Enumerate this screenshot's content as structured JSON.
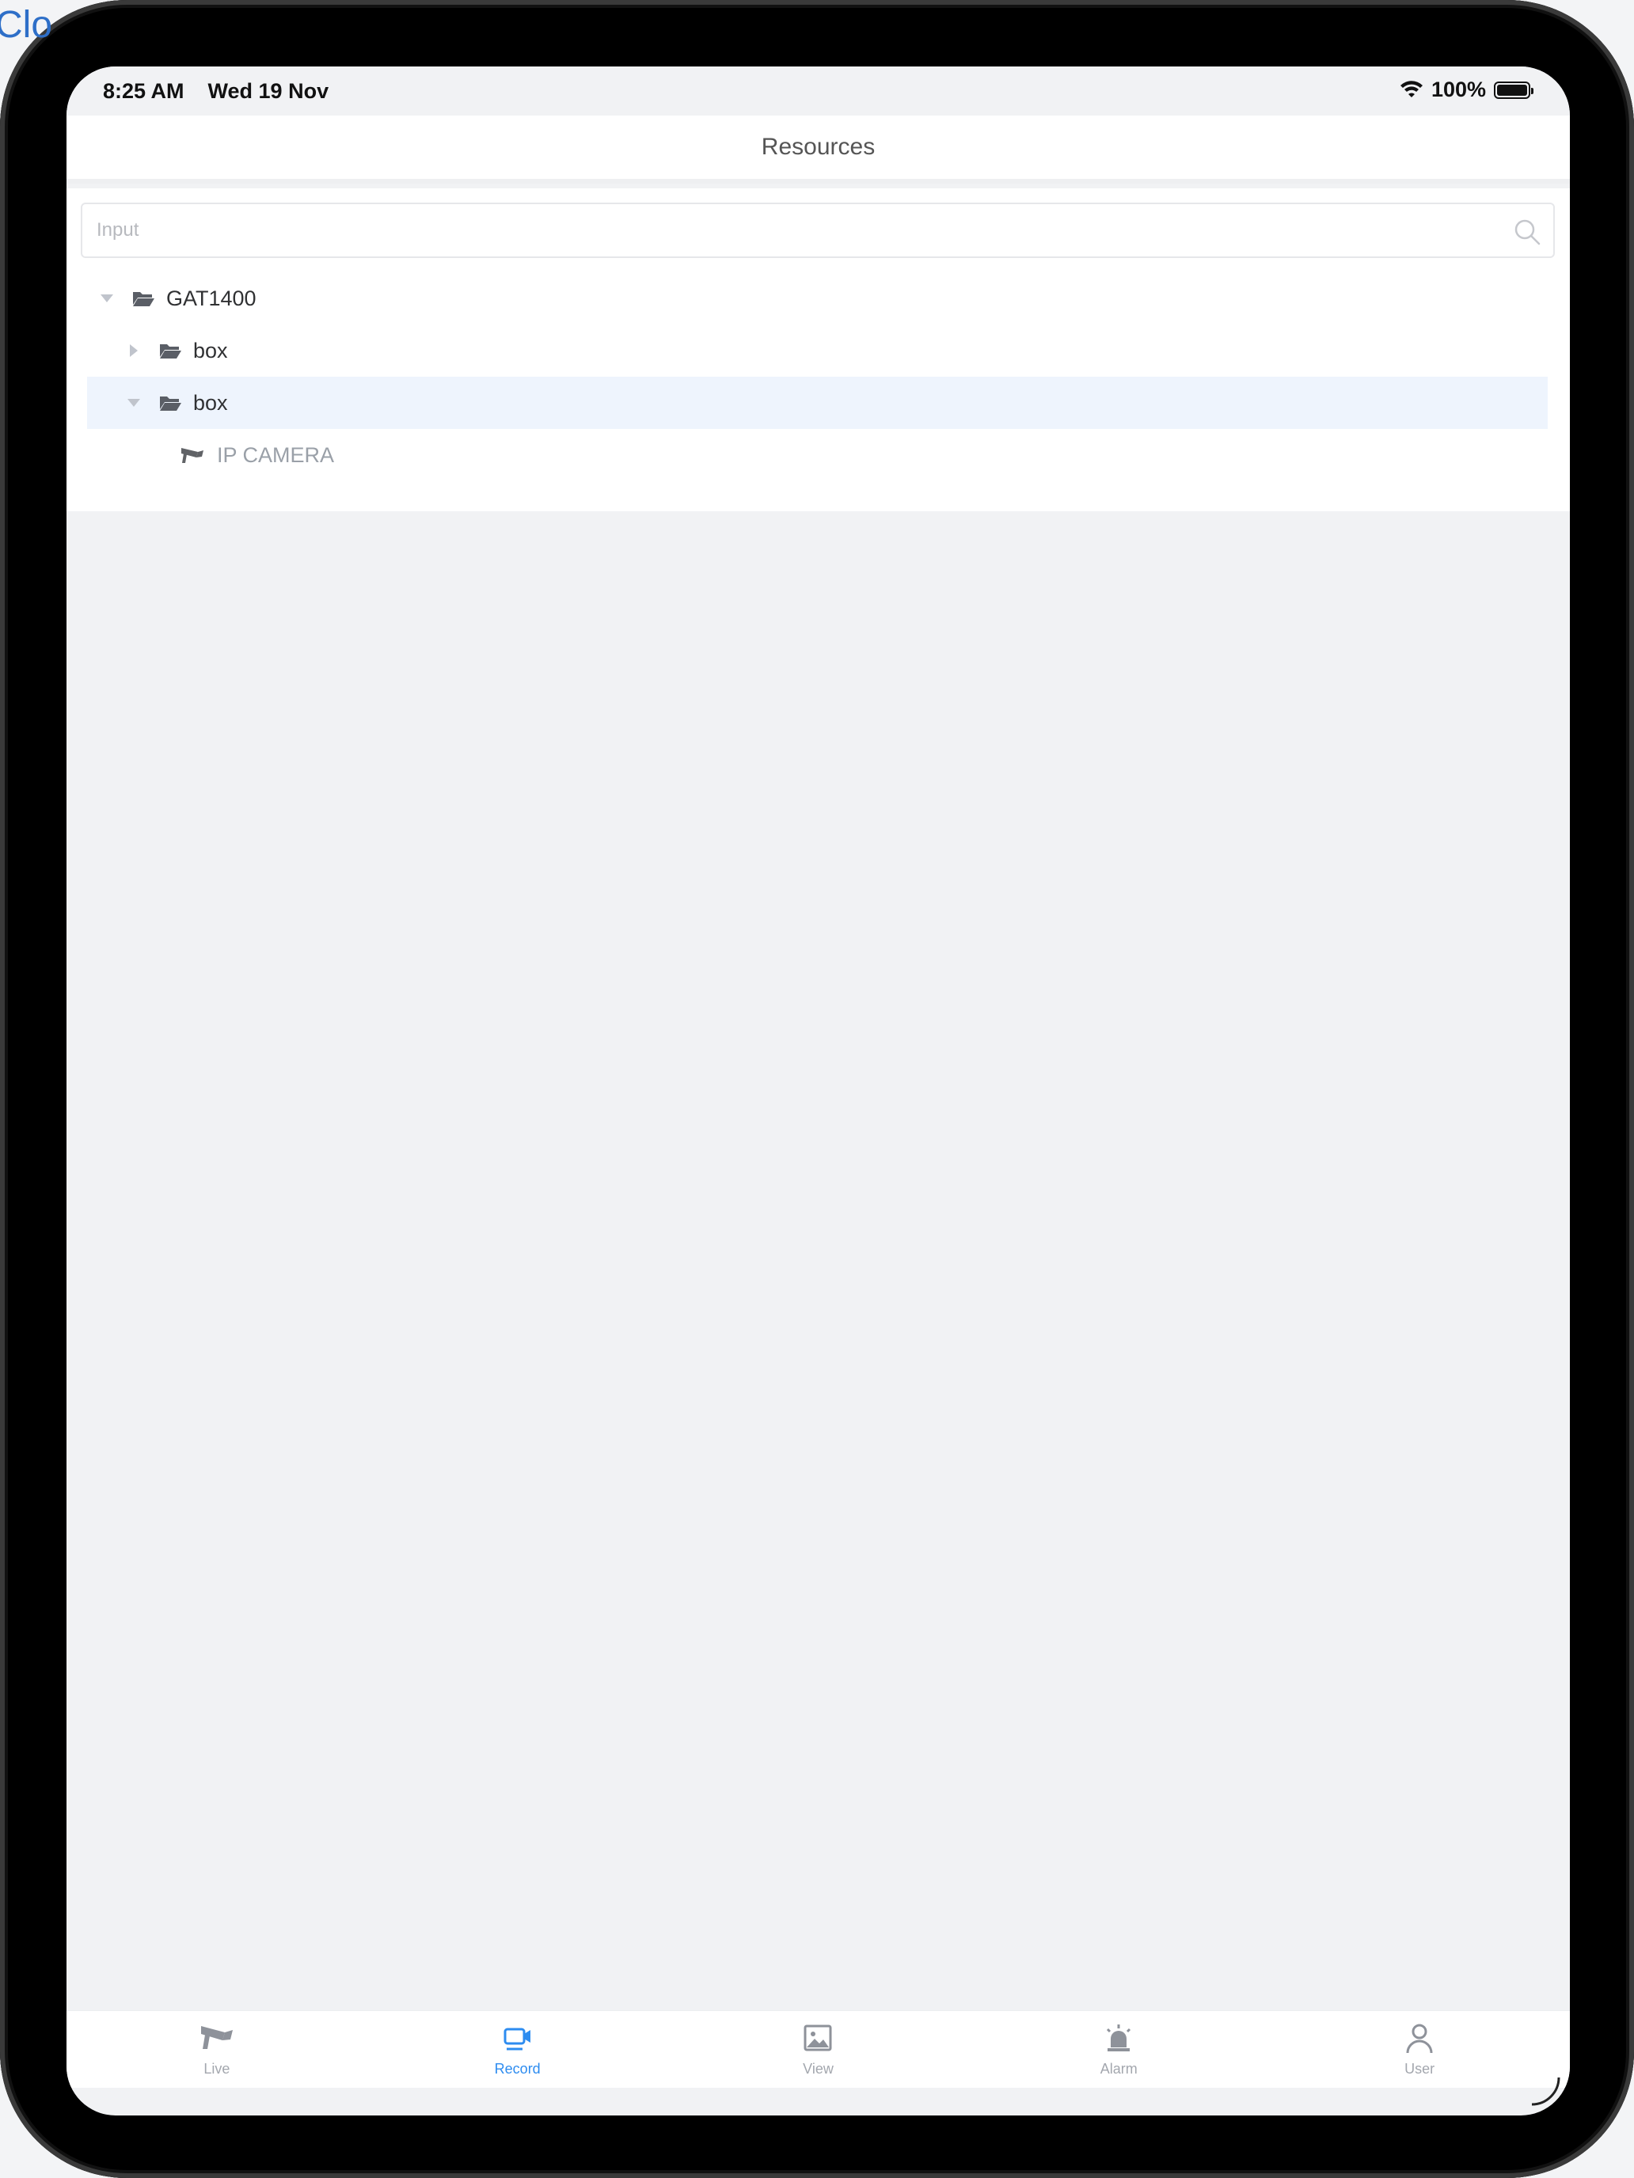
{
  "background": {
    "partial_text": "Clo"
  },
  "status_bar": {
    "time": "8:25 AM",
    "date": "Wed 19 Nov",
    "battery": "100%"
  },
  "header": {
    "title": "Resources"
  },
  "search": {
    "placeholder": "Input",
    "value": ""
  },
  "tree": {
    "root": {
      "label": "GAT1400",
      "expanded": true
    },
    "nodes": [
      {
        "label": "box",
        "expanded": false,
        "selected": false
      },
      {
        "label": "box",
        "expanded": true,
        "selected": true
      }
    ],
    "leaf": {
      "label": "IP CAMERA",
      "icon": "camera-icon",
      "online": false
    }
  },
  "tabs": [
    {
      "label": "Live",
      "icon": "camera-icon",
      "active": false
    },
    {
      "label": "Record",
      "icon": "video-icon",
      "active": true
    },
    {
      "label": "View",
      "icon": "image-icon",
      "active": false
    },
    {
      "label": "Alarm",
      "icon": "alarm-icon",
      "active": false
    },
    {
      "label": "User",
      "icon": "user-icon",
      "active": false
    }
  ],
  "colors": {
    "accent": "#2d8cf0",
    "selected_row": "#eef4fd",
    "page_bg": "#f1f2f4"
  }
}
